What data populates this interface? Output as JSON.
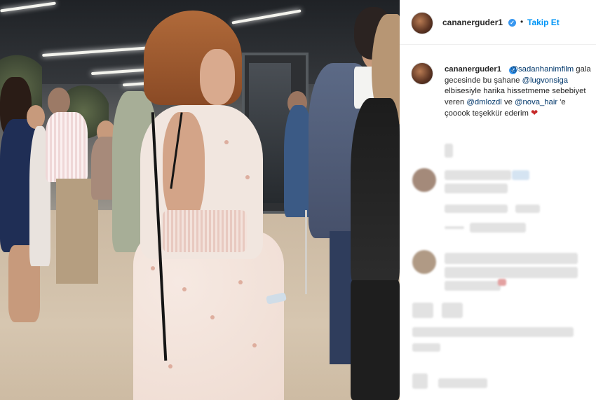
{
  "post": {
    "username": "cananerguder1",
    "verified": true,
    "separator": "•",
    "follow_label": "Takip Et"
  },
  "caption": {
    "username": "cananerguder1",
    "mention_1": "@sadanhanimfilm",
    "text_1": "gala gecesinde bu şahane",
    "mention_2": "@lugvonsiga",
    "text_2": "elbisesiyle harika hissetmeme sebebiyet veren",
    "mention_3": "@dmlozdl",
    "text_3": "ve",
    "mention_4": "@nova_hair",
    "text_4": "'e çooook teşekkür ederim",
    "emoji": "❤"
  },
  "comments_blurred": true,
  "colors": {
    "link_blue": "#0095f6",
    "mention_blue": "#00376b",
    "verified_blue": "#3897f0",
    "heart_red": "#c62828"
  },
  "icons": [
    "verified-badge-icon",
    "heart-emoji-icon"
  ]
}
